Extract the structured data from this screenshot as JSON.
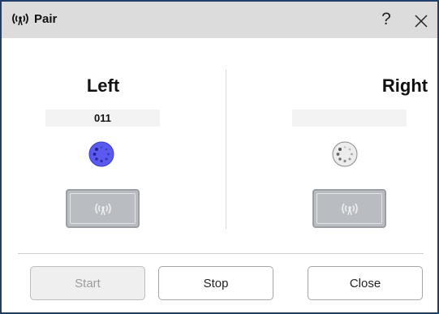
{
  "window": {
    "title": "Pair",
    "help_label": "?",
    "close_icon": "close-icon",
    "title_icon": "wireless-signal-icon"
  },
  "left": {
    "heading": "Left",
    "device_id": "011",
    "status_color": "#5a5af0",
    "status_icon": "spinner-icon",
    "pair_icon": "wireless-signal-icon"
  },
  "right": {
    "heading": "Right",
    "device_id": "",
    "status_color": "#e6e6e6",
    "status_icon": "spinner-icon",
    "pair_icon": "wireless-signal-icon"
  },
  "footer": {
    "start_label": "Start",
    "stop_label": "Stop",
    "close_label": "Close"
  },
  "colors": {
    "titlebar": "#dcdcdc",
    "window_border": "#1f3f68",
    "pair_button": "#b9bcc1"
  }
}
